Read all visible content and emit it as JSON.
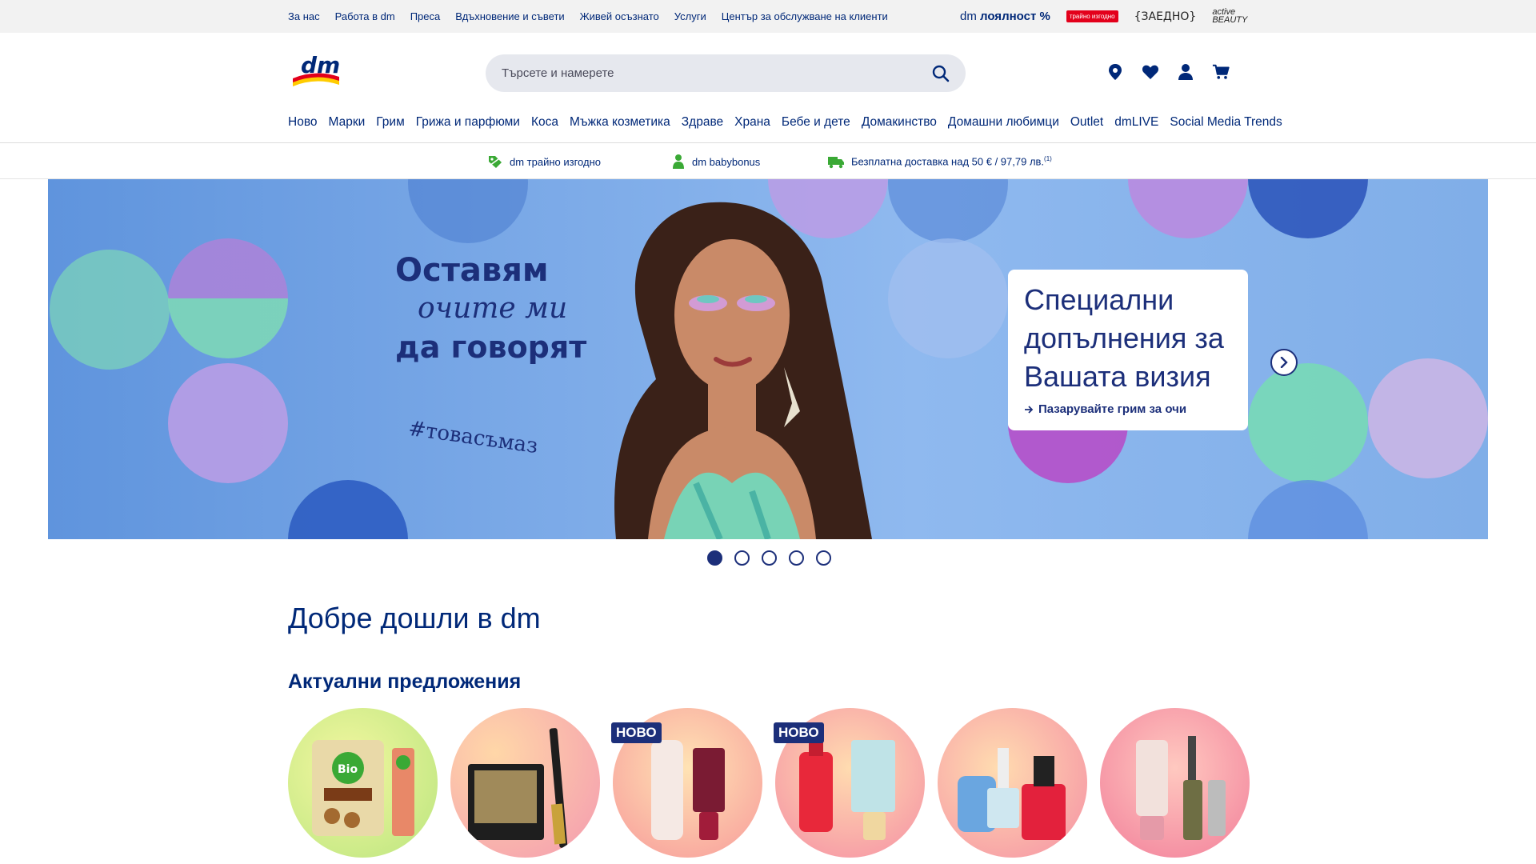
{
  "topbar": {
    "links": [
      "За нас",
      "Работа в dm",
      "Преса",
      "Вдъхновение и съвети",
      "Живей осъзнато",
      "Услуги",
      "Център за обслужване на клиенти"
    ],
    "loyalty_prefix": "dm",
    "loyalty_label": "лоялност %",
    "trayno_label": "трайно изгодно",
    "zaedno_label": "{ЗАЕДНО}",
    "active_label": "active BEAUTY"
  },
  "header": {
    "logo_text": "dm",
    "search_placeholder": "Търсете и намерете",
    "icons": [
      "location-pin-icon",
      "heart-icon",
      "user-icon",
      "cart-icon"
    ]
  },
  "nav": {
    "items": [
      "Ново",
      "Марки",
      "Грим",
      "Грижа и парфюми",
      "Коса",
      "Мъжка козметика",
      "Здраве",
      "Храна",
      "Бебе и дете",
      "Домакинство",
      "Домашни любимци",
      "Outlet",
      "dmLIVE",
      "Social Media Trends"
    ]
  },
  "benefits": [
    {
      "label": "dm трайно изгодно",
      "icon": "price-tag-icon"
    },
    {
      "label": "dm babybonus",
      "icon": "baby-icon"
    },
    {
      "label": "Безплатна доставка над 50 € / 97,79 лв.",
      "sup": "(1)",
      "icon": "truck-icon"
    }
  ],
  "hero": {
    "line1": "Оставям",
    "line2": "очите ми",
    "line3": "да говорят",
    "hashtag": "#товасъмаз",
    "card_title": "Специални допълнения за Вашата визия",
    "card_link": "Пазарувайте грим за очи",
    "slides_total": 5,
    "active_slide": 1
  },
  "welcome": "Добре дошли в dm",
  "offers": {
    "title": "Актуални предложения",
    "badge_new": "НОВО",
    "items": [
      {
        "name": "bio-cookies",
        "badge": false,
        "bg": "#d9ec8a"
      },
      {
        "name": "eyeshadow-eyeliner",
        "badge": false,
        "bg": "#f7b384"
      },
      {
        "name": "concealer-lip",
        "badge": true,
        "bg": "#f9a88f"
      },
      {
        "name": "nyx-lip-foundation",
        "badge": true,
        "bg": "#f8a08a"
      },
      {
        "name": "nail-polish",
        "badge": false,
        "bg": "#f6a98c"
      },
      {
        "name": "alverde-primer-mascara",
        "badge": false,
        "bg": "#f59ea0"
      }
    ]
  },
  "colors": {
    "brand_blue": "#002878",
    "dm_red": "#e3001b",
    "dm_yellow": "#ffcc00"
  }
}
